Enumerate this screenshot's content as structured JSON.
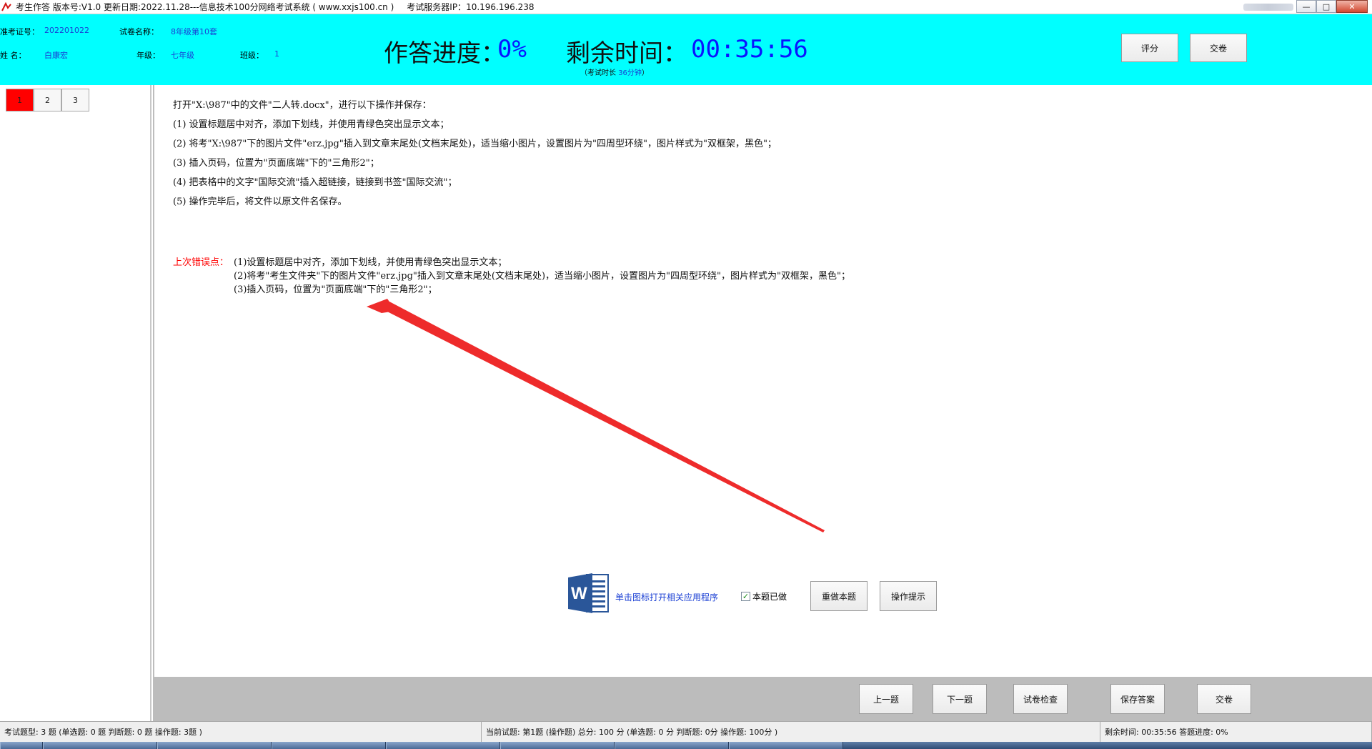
{
  "window": {
    "title": "考生作答 版本号:V1.0 更新日期:2022.11.28---信息技术100分网络考试系统  ( www.xxjs100.cn )",
    "server": "考试服务器IP：10.196.196.238"
  },
  "header": {
    "ticket_label": "准考证号：",
    "ticket_value": "202201022",
    "paper_label": "试卷名称：",
    "paper_value": "8年级第10套",
    "name_label": "姓      名：",
    "name_value": "白康宏",
    "grade_label": "年级：",
    "grade_value": "七年级",
    "class_label": "班级：",
    "class_value": "1",
    "progress_label": "作答进度：",
    "progress_value": "0%",
    "remaining_label": "剩余时间：",
    "remaining_value": "00:35:56",
    "duration_prefix": "（考试时长 ",
    "duration_value": "36分钟",
    "duration_suffix": "）",
    "score_button": "评分",
    "submit_button": "交卷"
  },
  "nav": {
    "questions": [
      "1",
      "2",
      "3"
    ],
    "current_index": 0,
    "current_color": "#ff0000"
  },
  "question": {
    "lines": [
      "打开\"X:\\987\"中的文件\"二人转.docx\"，进行以下操作并保存：",
      "(1) 设置标题居中对齐，添加下划线，并使用青绿色突出显示文本；",
      "(2) 将考\"X:\\987\"下的图片文件\"erz.jpg\"插入到文章末尾处(文档末尾处)，适当缩小图片，设置图片为\"四周型环绕\"，图片样式为\"双框架，黑色\"；",
      "(3) 插入页码，位置为\"页面底端\"下的\"三角形2\"；",
      "(4) 把表格中的文字\"国际交流\"插入超链接，链接到书签\"国际交流\"；",
      "(5) 操作完毕后，将文件以原文件名保存。"
    ],
    "last_errors_label": "上次错误点：",
    "last_errors": [
      "(1)设置标题居中对齐，添加下划线，并使用青绿色突出显示文本；",
      "(2)将考\"考生文件夹\"下的图片文件\"erz.jpg\"插入到文章末尾处(文档末尾处)，适当缩小图片，设置图片为\"四周型环绕\"，图片样式为\"双框架，黑色\"；",
      "(3)插入页码，位置为\"页面底端\"下的\"三角形2\"；"
    ],
    "open_app_text": "单击图标打开相关应用程序",
    "done_label": "本题已做",
    "done_checked": true,
    "redo_button": "重做本题",
    "hint_button": "操作提示"
  },
  "bottom": {
    "prev_button": "上一题",
    "next_button": "下一题",
    "check_button": "试卷检查",
    "save_button": "保存答案",
    "submit_button": "交卷"
  },
  "status": {
    "types": "考试题型: 3 题 (单选题: 0 题 判断题: 0 题 操作题: 3题 )",
    "current": "当前试题: 第1题 (操作题) 总分: 100 分 (单选题: 0 分 判断题: 0分 操作题: 100分 )",
    "remaining": "剩余时间: 00:35:56 答题进度: 0%"
  },
  "colors": {
    "header_bg": "#00ffff",
    "accent_blue": "#0a14ff",
    "error_red": "#ff0000",
    "arrow_red": "#ee2b2b"
  }
}
